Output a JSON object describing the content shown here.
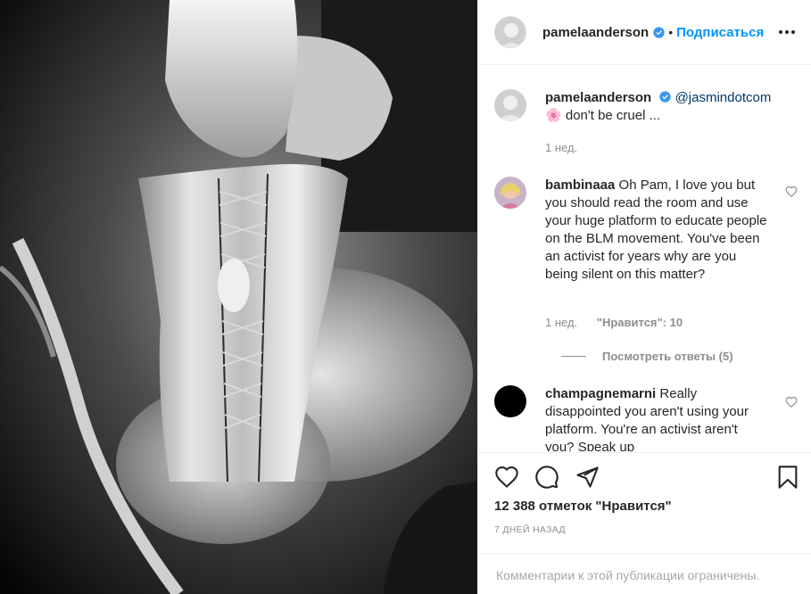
{
  "post": {
    "author": "pamelaanderson",
    "follow_label": "Подписаться",
    "dot": "•",
    "caption": {
      "username": "pamelaanderson",
      "mention": "@jasmindotcom",
      "emoji": "🌸",
      "text": "don't be cruel ...",
      "time": "1 нед."
    }
  },
  "comments": [
    {
      "username": "bambinaaa",
      "text": "Oh Pam, I love you but you should read the room and use your huge platform to educate people on the BLM movement. You've been an activist for years why are you being silent on this matter?",
      "time": "1 нед.",
      "likes": "\"Нравится\": 10",
      "view_replies": "Посмотреть ответы (5)"
    },
    {
      "username": "champagnemarni",
      "text": "Really disappointed you aren't using your platform. You're an activist aren't you? Speak up"
    }
  ],
  "footer": {
    "likes_count": "12 388 отметок \"Нравится\"",
    "time_ago": "7 ДНЕЙ НАЗАД",
    "comments_disabled": "Комментарии к этой публикации ограничены."
  },
  "icons": {
    "more": "more-options-icon",
    "like": "heart-icon",
    "comment": "comment-icon",
    "share": "paper-plane-icon",
    "save": "bookmark-icon",
    "verified": "verified-badge-icon"
  },
  "colors": {
    "accent": "#0095f6",
    "verified": "#3897f0",
    "muted": "#8e8e8e",
    "text": "#262626"
  }
}
